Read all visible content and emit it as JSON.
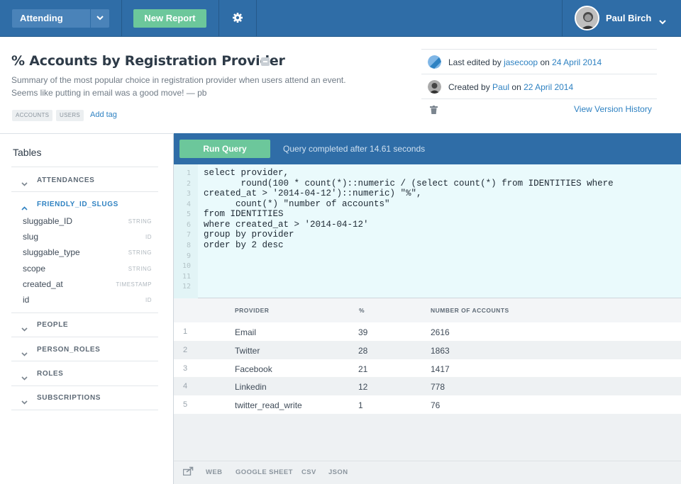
{
  "topbar": {
    "status_dropdown": "Attending",
    "new_report": "New Report",
    "user_name": "Paul Birch"
  },
  "report": {
    "title": "% Accounts by Registration Provider",
    "summary_line1": "Summary of the most popular choice in registration provider when users attend an event.",
    "summary_line2": "Seems like putting in email was a good move! — pb",
    "tags": [
      "ACCOUNTS",
      "USERS"
    ],
    "add_tag": "Add tag"
  },
  "meta": {
    "edited_prefix": "Last edited by ",
    "edited_by": "jasecoop",
    "edited_on_word": " on ",
    "edited_date": "24 April 2014",
    "created_prefix": "Created by ",
    "created_by": "Paul",
    "created_on_word": " on ",
    "created_date": "22 April 2014",
    "version_history": "View Version History"
  },
  "sidebar": {
    "heading": "Tables",
    "groups": [
      "ATTENDANCES",
      "FRIENDLY_ID_SLUGS",
      "PEOPLE",
      "PERSON_ROLES",
      "ROLES",
      "SUBSCRIPTIONS"
    ],
    "columns": [
      {
        "name": "sluggable_ID",
        "type": "STRING"
      },
      {
        "name": "slug",
        "type": "ID"
      },
      {
        "name": "sluggable_type",
        "type": "STRING"
      },
      {
        "name": "scope",
        "type": "STRING"
      },
      {
        "name": "created_at",
        "type": "TIMESTAMP"
      },
      {
        "name": "id",
        "type": "ID"
      }
    ]
  },
  "query": {
    "run_label": "Run Query",
    "status": "Query completed after 14.61 seconds",
    "line_numbers": [
      "1",
      "2",
      "3",
      "4",
      "5",
      "6",
      "7",
      "8",
      "9",
      "10",
      "11",
      "12"
    ],
    "lines": [
      "select provider,",
      "       round(100 * count(*)::numeric / (select count(*) from IDENTITIES where",
      "created_at > '2014-04-12')::numeric) \"%\",",
      "      count(*) \"number of accounts\"",
      "from IDENTITIES",
      "where created_at > '2014-04-12'",
      "group by provider",
      "order by 2 desc"
    ]
  },
  "results": {
    "headers": [
      "PROVIDER",
      "%",
      "NUMBER OF ACCOUNTS"
    ],
    "rows": [
      {
        "n": "1",
        "provider": "Email",
        "pct": "39",
        "count": "2616"
      },
      {
        "n": "2",
        "provider": "Twitter",
        "pct": "28",
        "count": "1863"
      },
      {
        "n": "3",
        "provider": "Facebook",
        "pct": "21",
        "count": "1417"
      },
      {
        "n": "4",
        "provider": "Linkedin",
        "pct": "12",
        "count": "778"
      },
      {
        "n": "5",
        "provider": "twitter_read_write",
        "pct": "1",
        "count": "76"
      }
    ]
  },
  "footer": {
    "web": "WEB",
    "google_sheet": "GOOGLE SHEET",
    "csv": "CSV",
    "json": "JSON"
  }
}
